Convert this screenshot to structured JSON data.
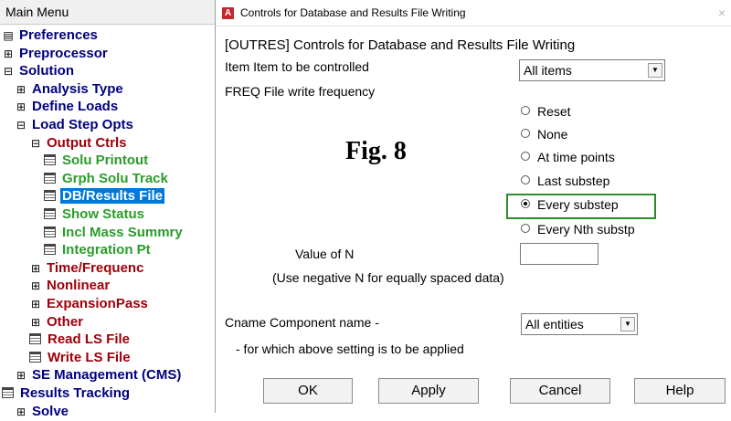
{
  "main_menu": {
    "title": "Main Menu",
    "items": [
      {
        "glyph": "square",
        "label": "Preferences",
        "color": "#000080"
      },
      {
        "glyph": "plus",
        "label": "Preprocessor",
        "color": "#000080"
      },
      {
        "glyph": "minus",
        "label": "Solution",
        "color": "#000080"
      },
      {
        "glyph": "plus",
        "label": "Analysis Type",
        "color": "#000080"
      },
      {
        "glyph": "plus",
        "label": "Define Loads",
        "color": "#000080"
      },
      {
        "glyph": "minus",
        "label": "Load Step Opts",
        "color": "#000080"
      },
      {
        "glyph": "minus",
        "label": "Output Ctrls",
        "color": "#a0000a"
      },
      {
        "glyph": "doc",
        "label": "Solu Printout",
        "color": "#2a9d2a"
      },
      {
        "glyph": "doc",
        "label": "Grph Solu Track",
        "color": "#2a9d2a"
      },
      {
        "glyph": "doc",
        "label": "DB/Results File",
        "color": "#2a9d2a",
        "selected": true
      },
      {
        "glyph": "doc",
        "label": "Show Status",
        "color": "#2a9d2a"
      },
      {
        "glyph": "doc",
        "label": "Incl Mass Summry",
        "color": "#2a9d2a"
      },
      {
        "glyph": "doc",
        "label": "Integration Pt",
        "color": "#2a9d2a"
      },
      {
        "glyph": "plus",
        "label": "Time/Frequenc",
        "color": "#a0000a"
      },
      {
        "glyph": "plus",
        "label": "Nonlinear",
        "color": "#a0000a"
      },
      {
        "glyph": "plus",
        "label": "ExpansionPass",
        "color": "#a0000a"
      },
      {
        "glyph": "plus",
        "label": "Other",
        "color": "#a0000a"
      },
      {
        "glyph": "doc",
        "label": "Read LS File",
        "color": "#a0000a"
      },
      {
        "glyph": "doc",
        "label": "Write LS File",
        "color": "#a0000a"
      },
      {
        "glyph": "plus",
        "label": "SE Management (CMS)",
        "color": "#000080"
      },
      {
        "glyph": "doc",
        "label": "Results Tracking",
        "color": "#000080"
      },
      {
        "glyph": "plus",
        "label": "Solve",
        "color": "#000080"
      }
    ]
  },
  "dialog": {
    "app_icon": "A",
    "title": "Controls for Database and Results File Writing",
    "close": "×",
    "heading": "[OUTRES]  Controls for Database and Results File Writing",
    "item_label": "Item  Item to be controlled",
    "item_value": "All items",
    "freq_label": "FREQ  File write frequency",
    "freq_options": [
      {
        "label": "Reset",
        "selected": false
      },
      {
        "label": "None",
        "selected": false
      },
      {
        "label": "At time points",
        "selected": false
      },
      {
        "label": "Last substep",
        "selected": false
      },
      {
        "label": "Every substep",
        "selected": true
      },
      {
        "label": "Every Nth substp",
        "selected": false
      }
    ],
    "value_n_label": "Value of N",
    "value_n": "",
    "negative_note": "(Use negative N for equally spaced data)",
    "cname_label": "Cname  Component name -",
    "cname_value": "All entities",
    "cname_note": "- for which above setting is to be applied",
    "buttons": {
      "ok": "OK",
      "apply": "Apply",
      "cancel": "Cancel",
      "help": "Help"
    },
    "figure_label": "Fig. 8"
  },
  "colors": {
    "selection": "#0078d7",
    "highlight_box": "#2e8b2e",
    "navy": "#000080",
    "red": "#a0000a",
    "green": "#2a9d2a"
  }
}
